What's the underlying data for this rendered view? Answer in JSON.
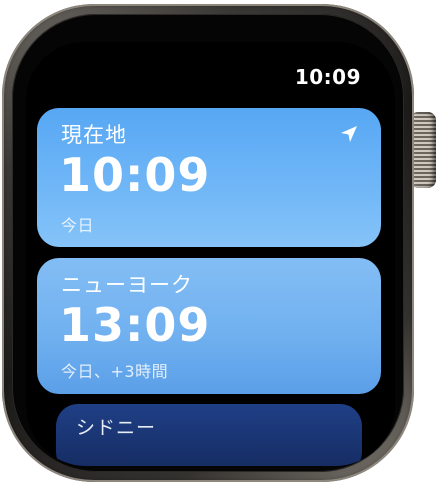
{
  "status_bar": {
    "time": "10:09"
  },
  "clocks": [
    {
      "city": "現在地",
      "time": "10:09",
      "subtitle": "今日",
      "icon": "location-arrow-icon"
    },
    {
      "city": "ニューヨーク",
      "time": "13:09",
      "subtitle": "今日、+3時間"
    },
    {
      "city": "シドニー"
    }
  ],
  "colors": {
    "background": "#000000",
    "card_top": "#57a7f4",
    "card_mid": "#7ab8f5",
    "card_partial": "#1f3f86",
    "text": "#ffffff"
  }
}
